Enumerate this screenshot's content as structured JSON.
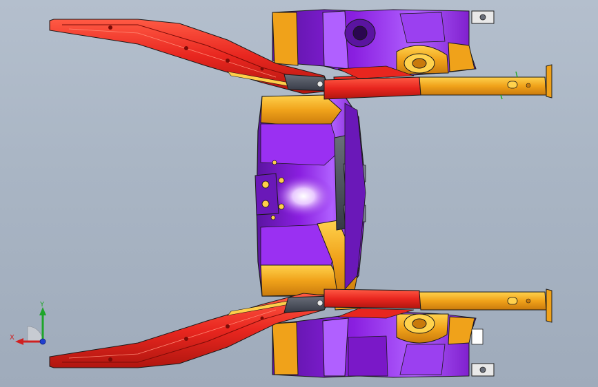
{
  "viewport": {
    "background_top": "#b4bfcd",
    "background_bottom": "#9fabbb"
  },
  "model": {
    "description_icon": "rear-subframe-assembly",
    "colors": {
      "red_member": "#e8261f",
      "red_dark": "#a8140e",
      "orange_member": "#f0a21a",
      "orange_light": "#ffcf4a",
      "purple_member": "#8a1fe0",
      "purple_light": "#c884ff",
      "purple_dark": "#4a0f86",
      "edge": "#1a1a1a"
    }
  },
  "triad": {
    "x_label": "X",
    "y_label": "Y",
    "x_color": "#d02020",
    "y_color": "#1fa52a",
    "z_color": "#1f3fd0"
  }
}
